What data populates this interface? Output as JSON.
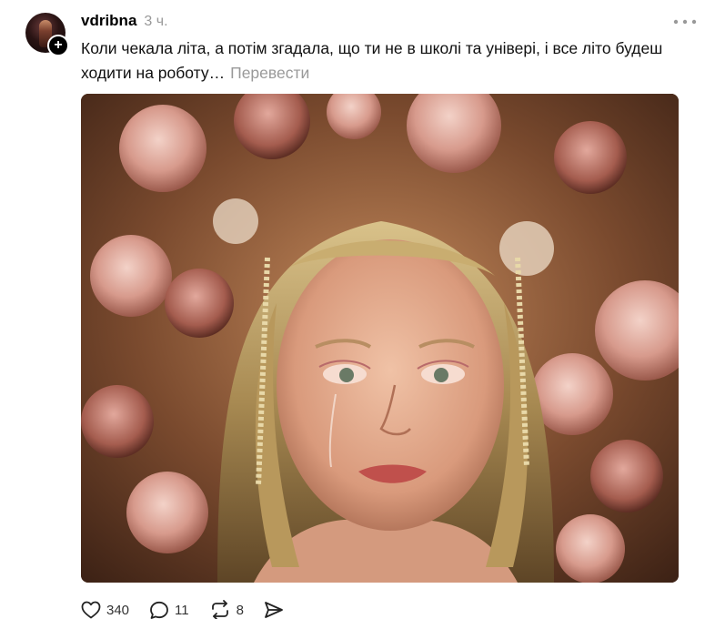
{
  "post": {
    "username": "vdribna",
    "timestamp": "3 ч.",
    "text": "Коли чекала літа, а потім згадала, що ти не в школі та універі, і все літо будеш ходити на роботу…",
    "translate_label": "Перевести",
    "more_icon": "more-horizontal-icon",
    "follow_icon": "plus-icon"
  },
  "actions": {
    "likes": "340",
    "comments": "11",
    "reposts": "8",
    "share_icon": "send-icon"
  },
  "colors": {
    "text": "#101010",
    "muted": "#999999"
  }
}
